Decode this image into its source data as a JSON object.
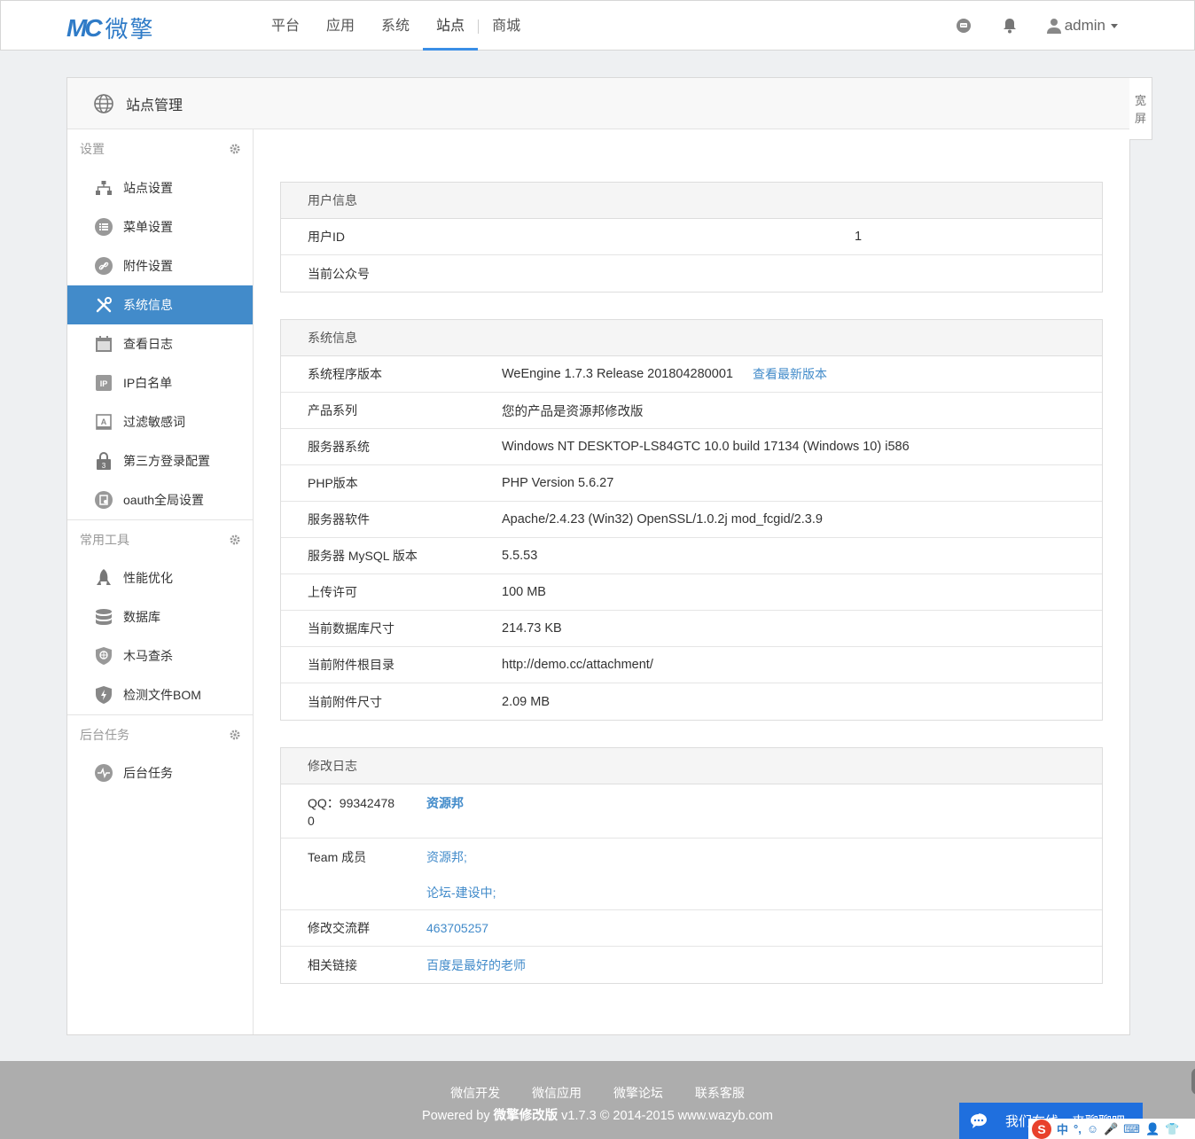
{
  "header": {
    "logo_mark": "MC",
    "logo_text": "微擎",
    "nav": [
      "平台",
      "应用",
      "系统",
      "站点",
      "商城"
    ],
    "active_nav": "站点",
    "user": "admin",
    "icons": [
      "message-icon",
      "bell-icon",
      "user-icon"
    ]
  },
  "panel": {
    "title": "站点管理",
    "wide_button": "宽屏"
  },
  "sidebar": {
    "groups": [
      {
        "label": "设置",
        "items": [
          {
            "label": "站点设置",
            "icon": "sitemap-icon"
          },
          {
            "label": "菜单设置",
            "icon": "list-icon"
          },
          {
            "label": "附件设置",
            "icon": "link-icon"
          },
          {
            "label": "系统信息",
            "icon": "tools-icon",
            "active": true
          },
          {
            "label": "查看日志",
            "icon": "calendar-icon"
          },
          {
            "label": "IP白名单",
            "icon": "ip-icon"
          },
          {
            "label": "过滤敏感词",
            "icon": "text-icon"
          },
          {
            "label": "第三方登录配置",
            "icon": "lock-icon"
          },
          {
            "label": "oauth全局设置",
            "icon": "oauth-icon"
          }
        ]
      },
      {
        "label": "常用工具",
        "items": [
          {
            "label": "性能优化",
            "icon": "rocket-icon"
          },
          {
            "label": "数据库",
            "icon": "database-icon"
          },
          {
            "label": "木马查杀",
            "icon": "shield-scan-icon"
          },
          {
            "label": "检测文件BOM",
            "icon": "shield-bolt-icon"
          }
        ]
      },
      {
        "label": "后台任务",
        "items": [
          {
            "label": "后台任务",
            "icon": "pulse-icon"
          }
        ]
      }
    ]
  },
  "user_info": {
    "title": "用户信息",
    "rows": [
      {
        "label": "用户ID",
        "value": "1"
      },
      {
        "label": "当前公众号",
        "value": ""
      }
    ]
  },
  "system_info": {
    "title": "系统信息",
    "rows": [
      {
        "label": "系统程序版本",
        "value": "WeEngine 1.7.3 Release 201804280001",
        "link": "查看最新版本"
      },
      {
        "label": "产品系列",
        "value": "您的产品是资源邦修改版"
      },
      {
        "label": "服务器系统",
        "value": "Windows NT DESKTOP-LS84GTC 10.0 build 17134 (Windows 10) i586"
      },
      {
        "label": "PHP版本",
        "value": "PHP Version 5.6.27"
      },
      {
        "label": "服务器软件",
        "value": "Apache/2.4.23 (Win32) OpenSSL/1.0.2j mod_fcgid/2.3.9"
      },
      {
        "label": "服务器 MySQL 版本",
        "value": "5.5.53"
      },
      {
        "label": "上传许可",
        "value": "100 MB"
      },
      {
        "label": "当前数据库尺寸",
        "value": "214.73 KB"
      },
      {
        "label": "当前附件根目录",
        "value": "http://demo.cc/attachment/"
      },
      {
        "label": "当前附件尺寸",
        "value": "2.09 MB"
      }
    ]
  },
  "changelog": {
    "title": "修改日志",
    "qq_label_1": "QQ：99342478",
    "qq_label_2": "0",
    "qq_link": "资源邦",
    "team_label": "Team 成员",
    "team_links": [
      "资源邦;",
      "论坛-建设中;"
    ],
    "group_label": "修改交流群",
    "group_value": "463705257",
    "links_label": "相关链接",
    "links_value": "百度是最好的老师"
  },
  "footer": {
    "links": [
      "微信开发",
      "微信应用",
      "微擎论坛",
      "联系客服"
    ],
    "copyright_prefix": "Powered by ",
    "copyright_brand": "微擎修改版",
    "copyright_suffix": " v1.7.3 © 2014-2015 www.wazyb.com"
  },
  "chat_widget": {
    "text": "我们在线，来聊聊吧"
  },
  "ime_bar": {
    "brand": "S",
    "mode": "中",
    "punct": "°,"
  }
}
